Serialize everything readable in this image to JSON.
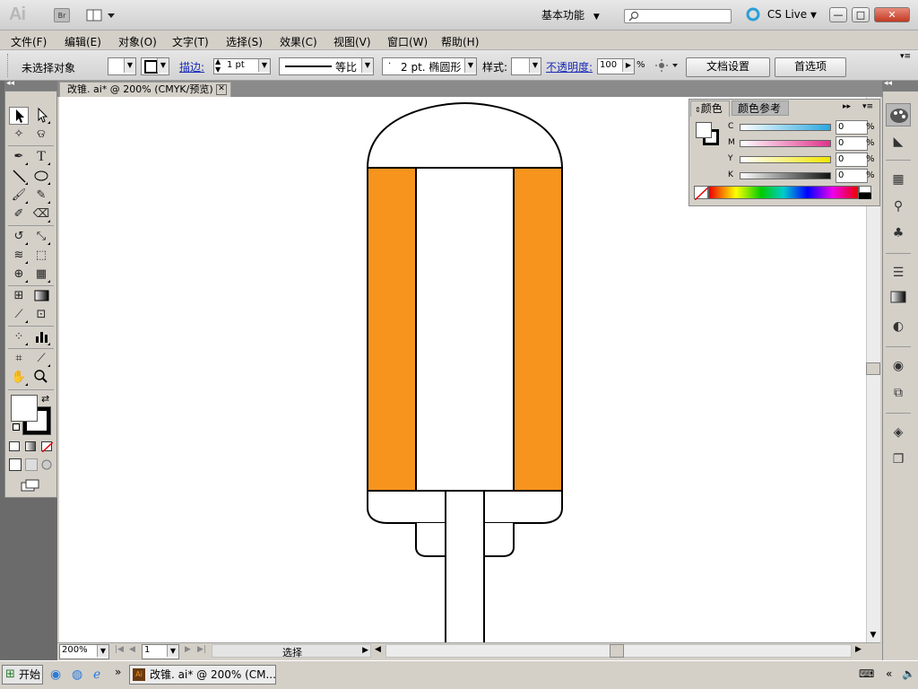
{
  "app": {
    "logo": "Ai",
    "bridge_label": "Br",
    "workspace_label": "基本功能",
    "cslive_label": "CS Live",
    "window_buttons": {
      "minimize": "—",
      "maximize": "□",
      "close": "✕"
    }
  },
  "menu": [
    "文件(F)",
    "编辑(E)",
    "对象(O)",
    "文字(T)",
    "选择(S)",
    "效果(C)",
    "视图(V)",
    "窗口(W)",
    "帮助(H)"
  ],
  "control": {
    "selection_status": "未选择对象",
    "stroke_label": "描边:",
    "stroke_weight": "1 pt",
    "stroke_profile": "等比",
    "brush": "2 pt. 椭圆形",
    "style_label": "样式:",
    "opacity_label": "不透明度:",
    "opacity_value": "100",
    "opacity_unit": "%",
    "doc_setup_button": "文档设置",
    "prefs_button": "首选项"
  },
  "document": {
    "tab_title": "改锥. ai* @ 200% (CMYK/预览)",
    "zoom": "200%",
    "artboard": "1",
    "status": "选择",
    "colors": {
      "orange": "#F7941D",
      "stroke": "#000000",
      "fill": "#FFFFFF"
    }
  },
  "color_panel": {
    "tab_color": "颜色",
    "tab_guide": "颜色参考",
    "channels": [
      {
        "label": "C",
        "value": "0",
        "unit": "%",
        "color": "#2aa8e0"
      },
      {
        "label": "M",
        "value": "0",
        "unit": "%",
        "color": "#e0338c"
      },
      {
        "label": "Y",
        "value": "0",
        "unit": "%",
        "color": "#f2e600"
      },
      {
        "label": "K",
        "value": "0",
        "unit": "%",
        "color": "#111111"
      }
    ]
  },
  "taskbar": {
    "start": "开始",
    "task_item": "改锥. ai* @ 200% (CM..."
  }
}
